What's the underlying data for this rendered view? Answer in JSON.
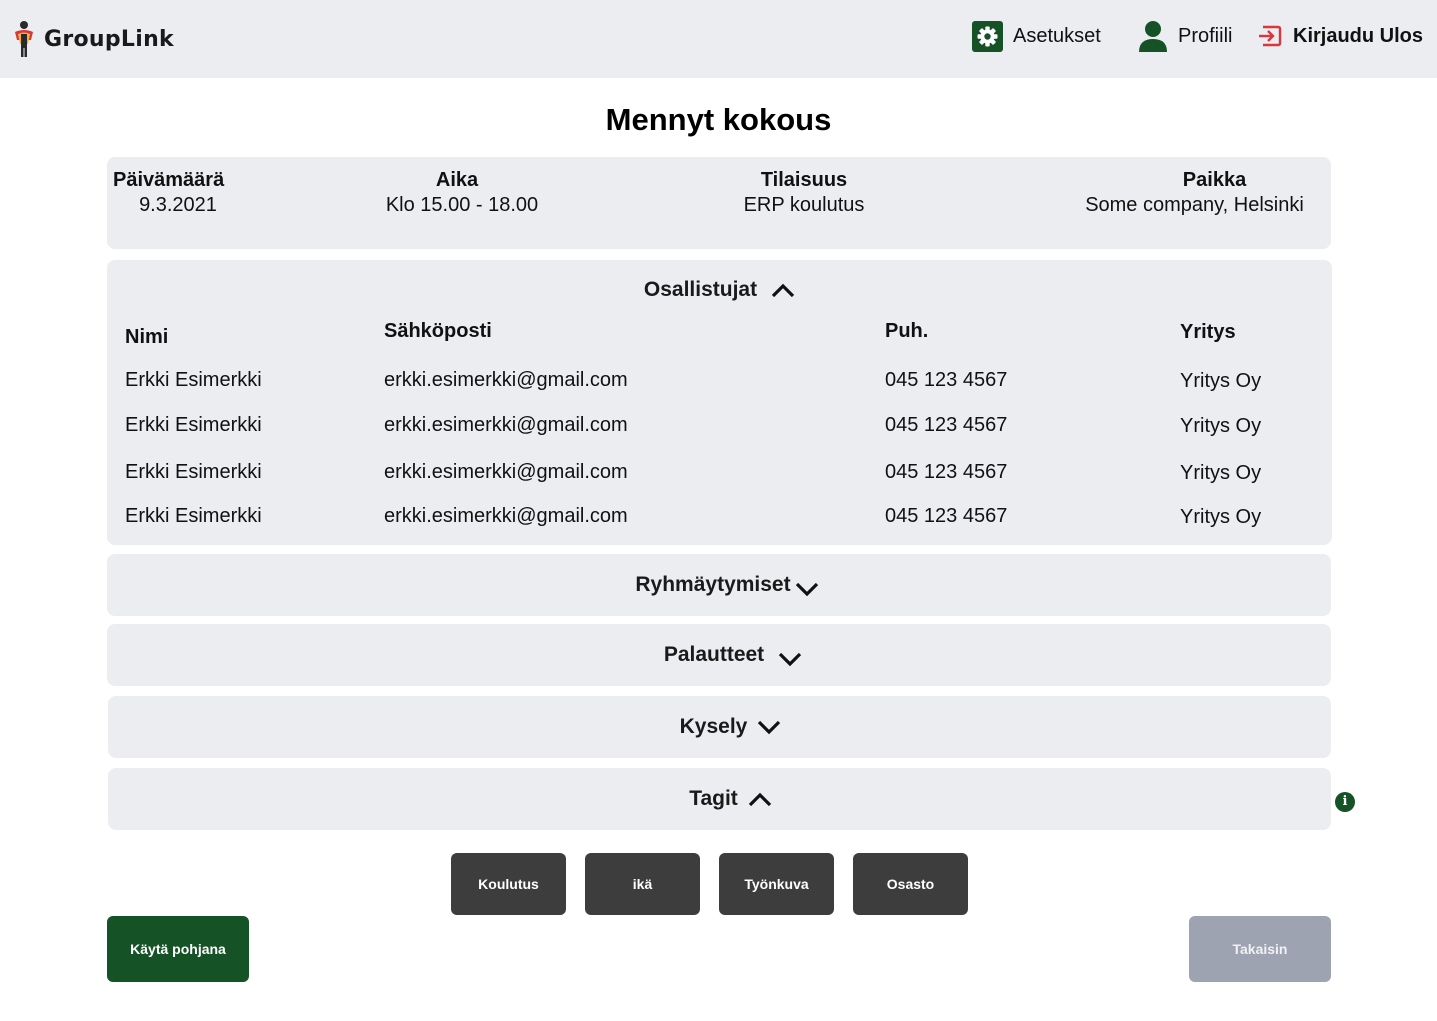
{
  "app": {
    "name": "GroupLink"
  },
  "nav": {
    "settings": "Asetukset",
    "profile": "Profiili",
    "logout": "Kirjaudu Ulos"
  },
  "page": {
    "title": "Mennyt kokous"
  },
  "meeting": {
    "date_label": "Päivämäärä",
    "date_value": "9.3.2021",
    "time_label": "Aika",
    "time_value": "Klo 15.00 - 18.00",
    "event_label": "Tilaisuus",
    "event_value": "ERP koulutus",
    "place_label": "Paikka",
    "place_value": "Some company, Helsinki"
  },
  "participants": {
    "title": "Osallistujat",
    "columns": [
      "Nimi",
      "Sähköposti",
      "Puh.",
      "Yritys"
    ],
    "rows": [
      [
        "Erkki Esimerkki",
        "erkki.esimerkki@gmail.com",
        "045 123 4567",
        "Yritys Oy"
      ],
      [
        "Erkki Esimerkki",
        "erkki.esimerkki@gmail.com",
        "045 123 4567",
        "Yritys Oy"
      ],
      [
        "Erkki Esimerkki",
        "erkki.esimerkki@gmail.com",
        "045 123 4567",
        "Yritys Oy"
      ],
      [
        "Erkki Esimerkki",
        "erkki.esimerkki@gmail.com",
        "045 123 4567",
        "Yritys Oy"
      ]
    ]
  },
  "sections": {
    "groupings": "Ryhmäytymiset",
    "feedback": "Palautteet",
    "survey": "Kysely",
    "tags": "Tagit"
  },
  "tags": [
    "Koulutus",
    "ikä",
    "Työnkuva",
    "Osasto"
  ],
  "info_icon_glyph": "i",
  "buttons": {
    "use_template": "Käytä pohjana",
    "back": "Takaisin"
  },
  "colors": {
    "accent_green": "#155226",
    "panel_bg": "#ebedf1",
    "tag_bg": "#3d3d3d",
    "logout_red": "#d9363e",
    "back_button": "#9ea3b1"
  },
  "icons": {
    "settings": "gear-icon",
    "profile": "user-icon",
    "logout": "logout-icon",
    "expanded": "chevron-up-icon",
    "collapsed": "chevron-down-icon",
    "info": "info-icon"
  }
}
